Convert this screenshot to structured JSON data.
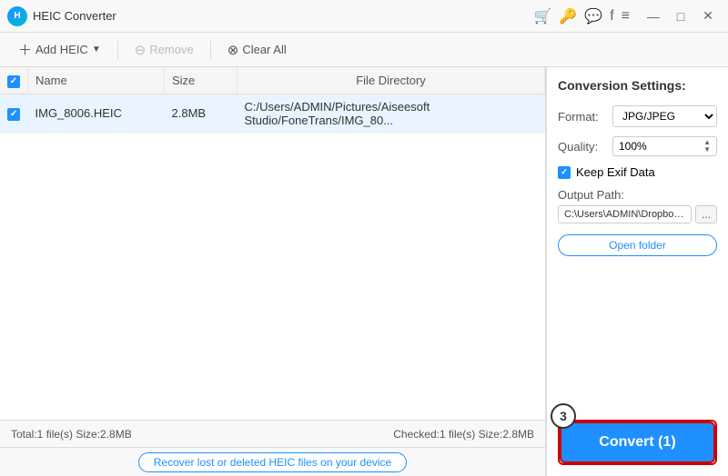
{
  "titleBar": {
    "appName": "HEIC Converter",
    "logoText": "H",
    "controls": {
      "minimize": "—",
      "maximize": "□",
      "close": "✕"
    }
  },
  "toolbar": {
    "addHeic": "Add HEIC",
    "remove": "Remove",
    "clearAll": "Clear All"
  },
  "table": {
    "headers": [
      "",
      "Name",
      "Size",
      "File Directory"
    ],
    "rows": [
      {
        "checked": true,
        "name": "IMG_8006.HEIC",
        "size": "2.8MB",
        "directory": "C:/Users/ADMIN/Pictures/Aiseesoft Studio/FoneTrans/IMG_80..."
      }
    ]
  },
  "statusBar": {
    "left": "Total:1 file(s) Size:2.8MB",
    "right": "Checked:1 file(s) Size:2.8MB"
  },
  "recoverBar": {
    "linkText": "Recover lost or deleted HEIC files on your device"
  },
  "settings": {
    "title": "Conversion Settings:",
    "formatLabel": "Format:",
    "formatValue": "JPG/JPEG",
    "qualityLabel": "Quality:",
    "qualityValue": "100%",
    "keepExifLabel": "Keep Exif Data",
    "outputPathLabel": "Output Path:",
    "outputPathValue": "C:\\Users\\ADMIN\\Dropbox\\PC\\",
    "browseBtn": "...",
    "openFolderBtn": "Open folder"
  },
  "convert": {
    "stepBadge": "3",
    "buttonLabel": "Convert (1)"
  }
}
